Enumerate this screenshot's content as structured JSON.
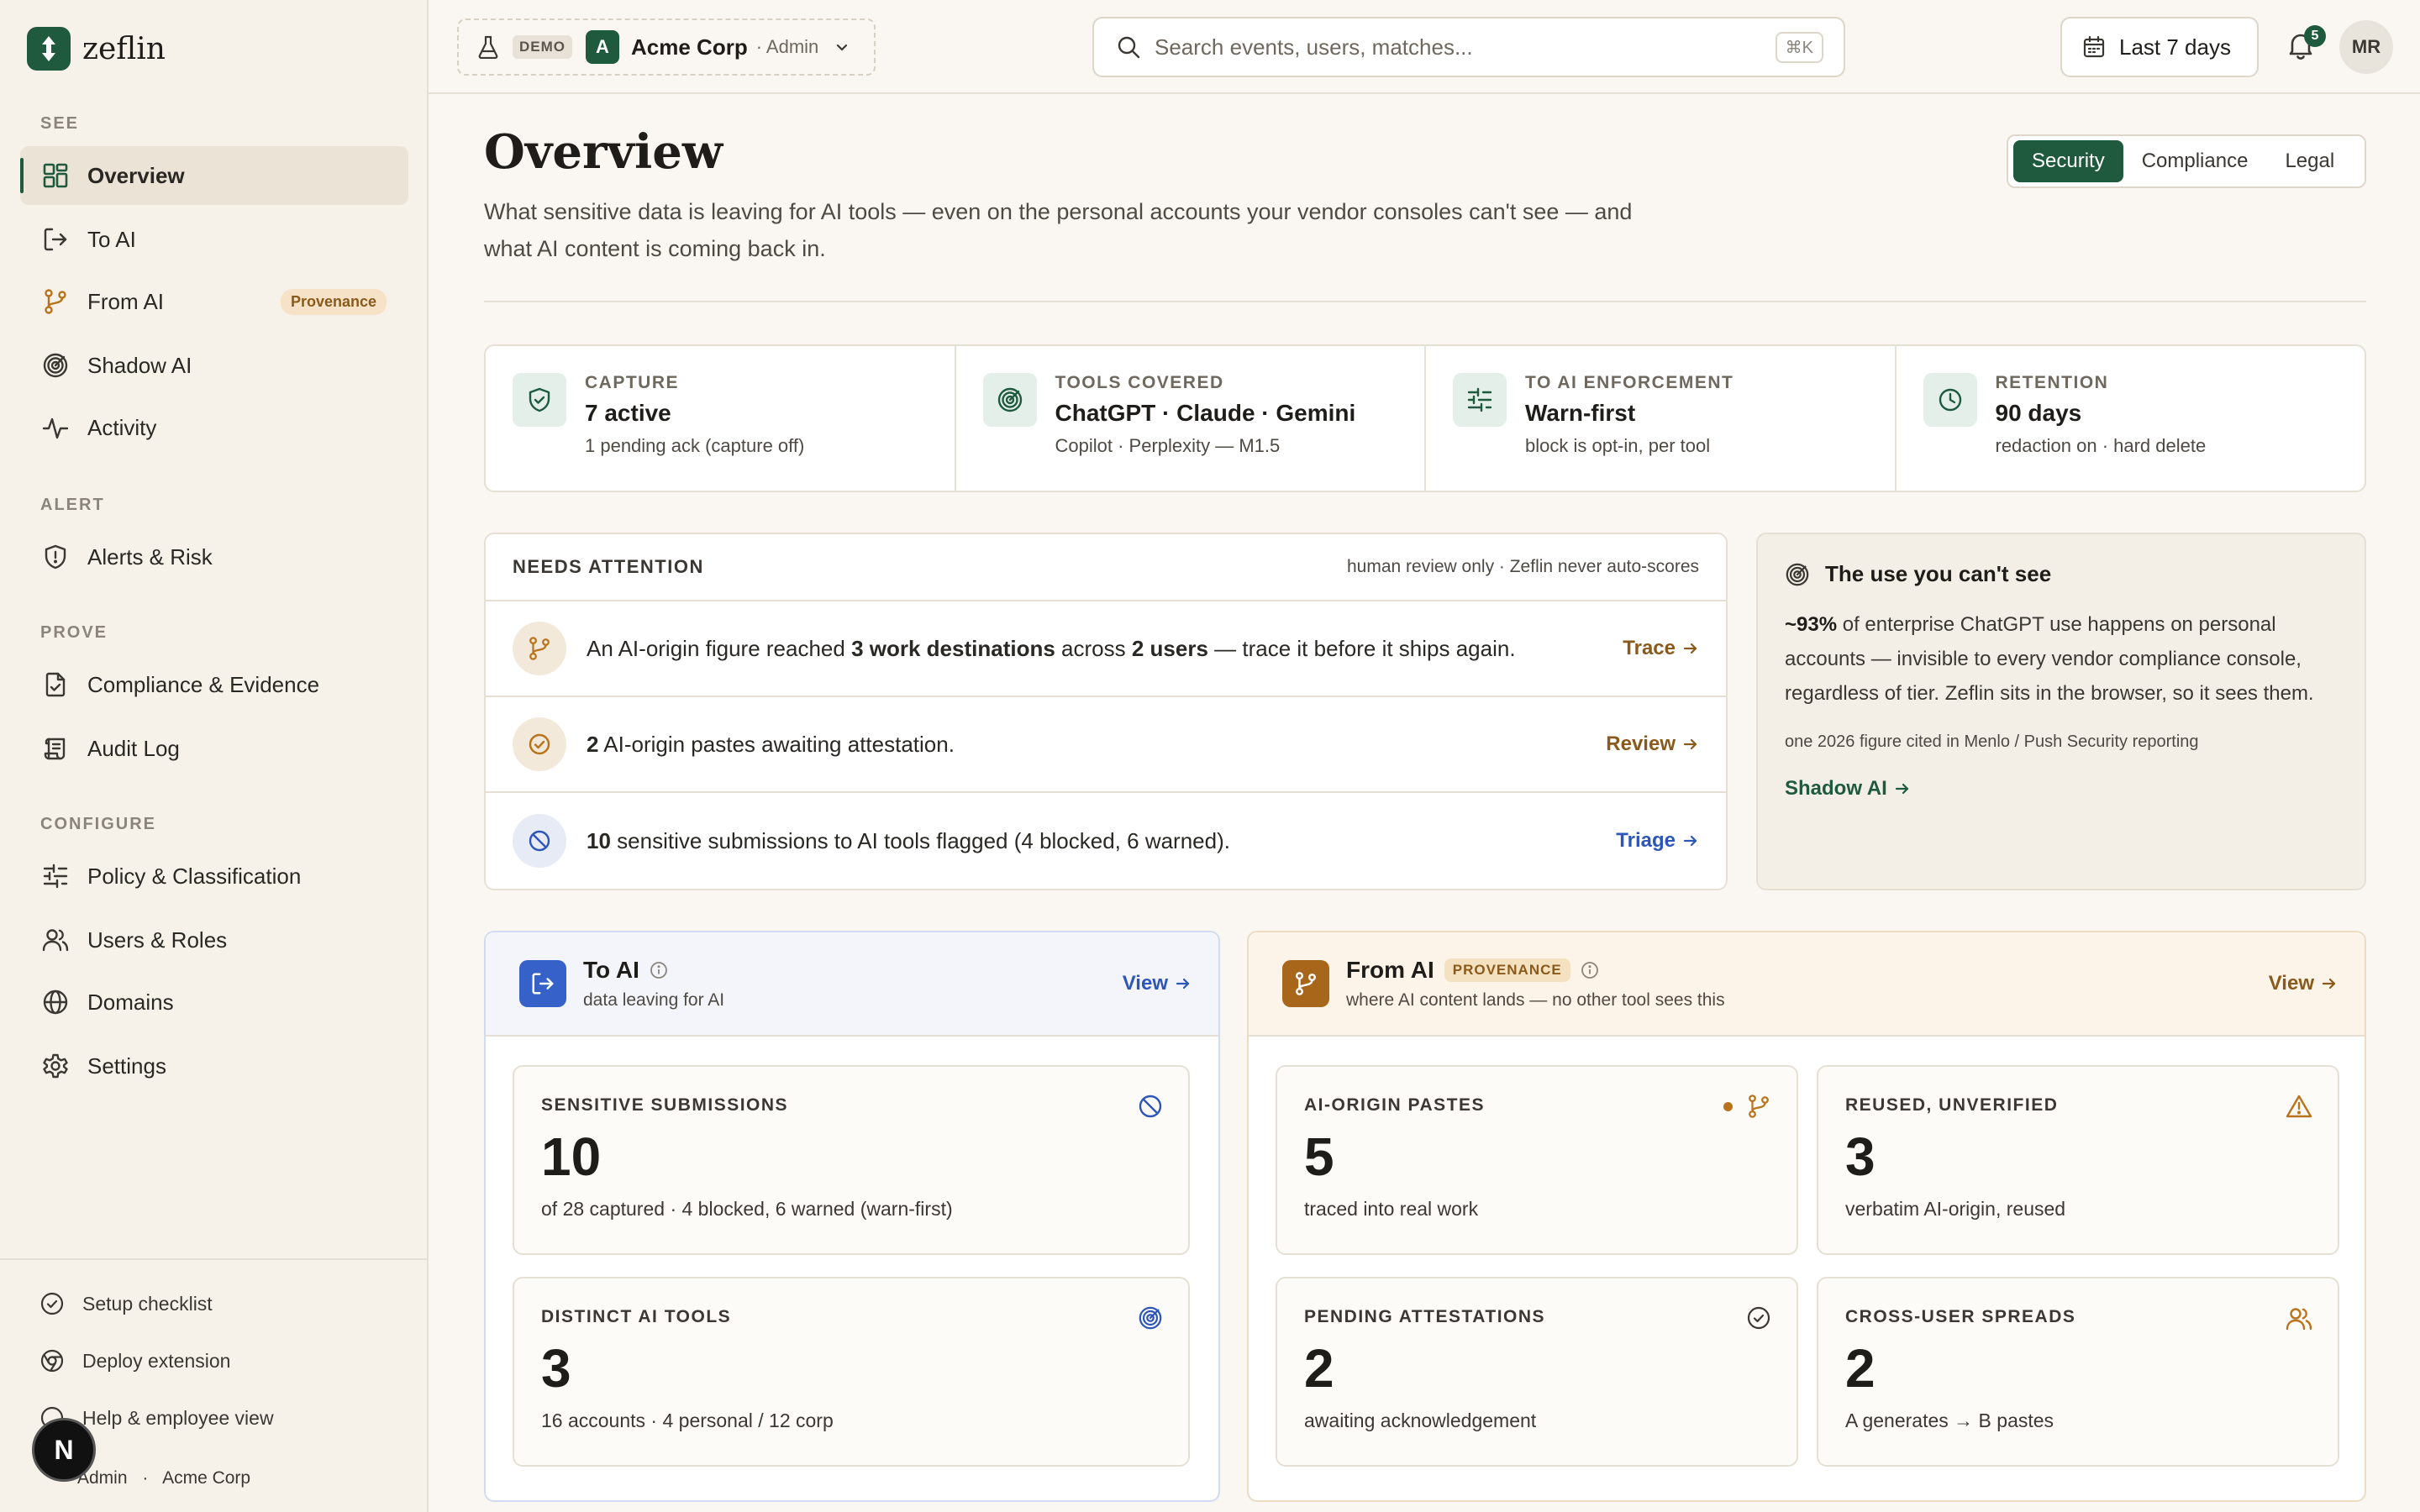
{
  "brand": {
    "name": "zeflin"
  },
  "sidebar": {
    "sections": {
      "see": "SEE",
      "alert": "ALERT",
      "prove": "PROVE",
      "configure": "CONFIGURE"
    },
    "items": [
      {
        "label": "Overview",
        "icon": "grid-icon",
        "active": true
      },
      {
        "label": "To AI",
        "icon": "arrow-out-icon"
      },
      {
        "label": "From AI",
        "icon": "branch-icon",
        "badge": "Provenance"
      },
      {
        "label": "Shadow AI",
        "icon": "radar-icon"
      },
      {
        "label": "Activity",
        "icon": "pulse-icon"
      },
      {
        "label": "Alerts & Risk",
        "icon": "shield-alert-icon"
      },
      {
        "label": "Compliance & Evidence",
        "icon": "file-check-icon"
      },
      {
        "label": "Audit Log",
        "icon": "scroll-icon"
      },
      {
        "label": "Policy & Classification",
        "icon": "sliders-icon"
      },
      {
        "label": "Users & Roles",
        "icon": "users-icon"
      },
      {
        "label": "Domains",
        "icon": "globe-icon"
      },
      {
        "label": "Settings",
        "icon": "gear-icon"
      }
    ],
    "footer": {
      "setup": "Setup checklist",
      "deploy": "Deploy extension",
      "help": "Help & employee view",
      "role": "Admin",
      "sep": "·",
      "org": "Acme Corp",
      "bubble": "N"
    }
  },
  "topbar": {
    "demo": "DEMO",
    "tenant_initial": "A",
    "tenant_name": "Acme Corp",
    "tenant_role": "· Admin",
    "search_placeholder": "Search events, users, matches...",
    "search_kbd": "⌘K",
    "range": "Last 7 days",
    "notifications": "5",
    "user_initials": "MR"
  },
  "page": {
    "title": "Overview",
    "subtitle": "What sensitive data is leaving for AI tools — even on the personal accounts your vendor consoles can't see — and what AI content is coming back in.",
    "tabs": [
      "Security",
      "Compliance",
      "Legal"
    ],
    "active_tab": "Security"
  },
  "stats": [
    {
      "key": "CAPTURE",
      "value": "7 active",
      "sub": "1 pending ack (capture off)",
      "icon": "shield-check-icon"
    },
    {
      "key": "TOOLS COVERED",
      "value": "ChatGPT · Claude · Gemini",
      "sub": "Copilot · Perplexity — M1.5",
      "icon": "radar-icon"
    },
    {
      "key": "TO AI ENFORCEMENT",
      "value": "Warn-first",
      "sub": "block is opt-in, per tool",
      "icon": "sliders-icon"
    },
    {
      "key": "RETENTION",
      "value": "90 days",
      "sub": "redaction on · hard delete",
      "icon": "clock-icon"
    }
  ],
  "attention": {
    "title": "NEEDS ATTENTION",
    "note": "human review only · Zeflin never auto-scores",
    "rows": [
      {
        "p1": "An AI-origin figure reached ",
        "b1": "3 work destinations",
        "p2": " across ",
        "b2": "2 users",
        "p3": " — trace it before it ships again.",
        "action": "Trace"
      },
      {
        "b1": "2",
        "p1": " AI-origin pastes awaiting attestation.",
        "action": "Review"
      },
      {
        "b1": "10",
        "p1": " sensitive submissions to AI tools flagged (4 blocked, 6 warned).",
        "action": "Triage"
      }
    ]
  },
  "unseen": {
    "title": "The use you can't see",
    "bold": "~93%",
    "body": " of enterprise ChatGPT use happens on personal accounts — invisible to every vendor compliance console, regardless of tier. Zeflin sits in the browser, so it sees them.",
    "foot": "one 2026 figure cited in Menlo / Push Security reporting",
    "link": "Shadow AI"
  },
  "to_ai": {
    "title": "To AI",
    "sub": "data leaving for AI",
    "view": "View",
    "cards": [
      {
        "key": "SENSITIVE SUBMISSIONS",
        "value": "10",
        "sub": "of 28 captured · 4 blocked, 6 warned (warn-first)",
        "icon": "ban-icon"
      },
      {
        "key": "DISTINCT AI TOOLS",
        "value": "3",
        "sub": "16 accounts · 4 personal / 12 corp",
        "icon": "radar-icon"
      }
    ]
  },
  "from_ai": {
    "title": "From AI",
    "tag": "PROVENANCE",
    "sub": "where AI content lands — no other tool sees this",
    "view": "View",
    "cards": [
      {
        "key": "AI-ORIGIN PASTES",
        "value": "5",
        "sub": "traced into real work",
        "icon": "branch-icon"
      },
      {
        "key": "REUSED, UNVERIFIED",
        "value": "3",
        "sub": "verbatim AI-origin, reused",
        "icon": "warning-icon"
      },
      {
        "key": "PENDING ATTESTATIONS",
        "value": "2",
        "sub": "awaiting acknowledgement",
        "icon": "check-circle-icon"
      },
      {
        "key": "CROSS-USER SPREADS",
        "value": "2",
        "sub": "A generates → B pastes",
        "icon": "users-icon"
      }
    ]
  },
  "colors": {
    "brand": "#1f5a3e",
    "amber": "#8a5a1c",
    "blue": "#2d56b8",
    "bg": "#faf7f2"
  }
}
